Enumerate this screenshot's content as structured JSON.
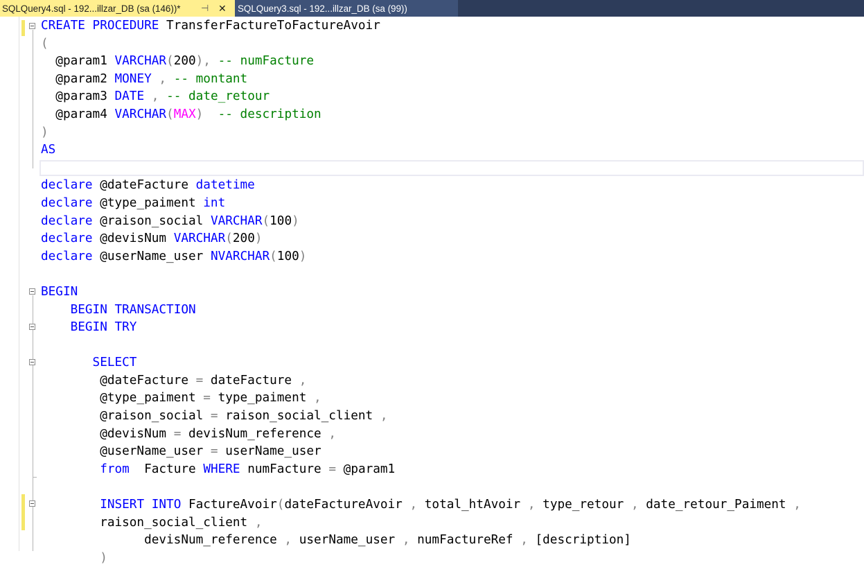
{
  "tabs": [
    {
      "label": "SQLQuery4.sql - 192...illzar_DB (sa (146))*",
      "active": true
    },
    {
      "label": "SQLQuery3.sql - 192...illzar_DB (sa (99))",
      "active": false
    }
  ],
  "tab_icons": {
    "pin": "pin-icon",
    "close": "close-icon"
  },
  "colors": {
    "keyword": "#0000ff",
    "comment": "#008000",
    "operator": "#808080",
    "function": "#ff00ff",
    "active_tab": "#ffef8f",
    "inactive_tab": "#3e5278",
    "tabbar": "#2d3c5a"
  },
  "code_lines": [
    [
      [
        "kw",
        "CREATE PROCEDURE"
      ],
      [
        "t",
        " TransferFactureToFactureAvoir"
      ]
    ],
    [
      [
        "gr",
        "("
      ]
    ],
    [
      [
        "t",
        "  @param1 "
      ],
      [
        "kw",
        "VARCHAR"
      ],
      [
        "gr",
        "("
      ],
      [
        "t",
        "200"
      ],
      [
        "gr",
        "),"
      ],
      [
        "cm",
        " -- numFacture"
      ]
    ],
    [
      [
        "t",
        "  @param2 "
      ],
      [
        "kw",
        "MONEY"
      ],
      [
        "gr",
        " ,"
      ],
      [
        "cm",
        " -- montant"
      ]
    ],
    [
      [
        "t",
        "  @param3 "
      ],
      [
        "kw",
        "DATE"
      ],
      [
        "gr",
        " ,"
      ],
      [
        "cm",
        " -- date_retour"
      ]
    ],
    [
      [
        "t",
        "  @param4 "
      ],
      [
        "kw",
        "VARCHAR"
      ],
      [
        "gr",
        "("
      ],
      [
        "fn",
        "MAX"
      ],
      [
        "gr",
        ")"
      ],
      [
        "cm",
        "  -- description"
      ]
    ],
    [
      [
        "gr",
        ")"
      ]
    ],
    [
      [
        "kw",
        "AS"
      ]
    ],
    [],
    [
      [
        "kw",
        "declare"
      ],
      [
        "t",
        " @dateFacture "
      ],
      [
        "kw",
        "datetime"
      ]
    ],
    [
      [
        "kw",
        "declare"
      ],
      [
        "t",
        " @type_paiment "
      ],
      [
        "kw",
        "int"
      ]
    ],
    [
      [
        "kw",
        "declare"
      ],
      [
        "t",
        " @raison_social "
      ],
      [
        "kw",
        "VARCHAR"
      ],
      [
        "gr",
        "("
      ],
      [
        "t",
        "100"
      ],
      [
        "gr",
        ")"
      ]
    ],
    [
      [
        "kw",
        "declare"
      ],
      [
        "t",
        " @devisNum "
      ],
      [
        "kw",
        "VARCHAR"
      ],
      [
        "gr",
        "("
      ],
      [
        "t",
        "200"
      ],
      [
        "gr",
        ")"
      ]
    ],
    [
      [
        "kw",
        "declare"
      ],
      [
        "t",
        " @userName_user "
      ],
      [
        "kw",
        "NVARCHAR"
      ],
      [
        "gr",
        "("
      ],
      [
        "t",
        "100"
      ],
      [
        "gr",
        ")"
      ]
    ],
    [],
    [
      [
        "kw",
        "BEGIN"
      ]
    ],
    [
      [
        "t",
        "    "
      ],
      [
        "kw",
        "BEGIN TRANSACTION"
      ]
    ],
    [
      [
        "t",
        "    "
      ],
      [
        "kw",
        "BEGIN TRY"
      ]
    ],
    [],
    [
      [
        "t",
        "       "
      ],
      [
        "kw",
        "SELECT"
      ]
    ],
    [
      [
        "t",
        "        @dateFacture "
      ],
      [
        "gr",
        "="
      ],
      [
        "t",
        " dateFacture "
      ],
      [
        "gr",
        ","
      ]
    ],
    [
      [
        "t",
        "        @type_paiment "
      ],
      [
        "gr",
        "="
      ],
      [
        "t",
        " type_paiment "
      ],
      [
        "gr",
        ","
      ]
    ],
    [
      [
        "t",
        "        @raison_social "
      ],
      [
        "gr",
        "="
      ],
      [
        "t",
        " raison_social_client "
      ],
      [
        "gr",
        ","
      ]
    ],
    [
      [
        "t",
        "        @devisNum "
      ],
      [
        "gr",
        "="
      ],
      [
        "t",
        " devisNum_reference "
      ],
      [
        "gr",
        ","
      ]
    ],
    [
      [
        "t",
        "        @userName_user "
      ],
      [
        "gr",
        "="
      ],
      [
        "t",
        " userName_user"
      ]
    ],
    [
      [
        "t",
        "        "
      ],
      [
        "kw",
        "from"
      ],
      [
        "t",
        "  Facture "
      ],
      [
        "kw",
        "WHERE"
      ],
      [
        "t",
        " numFacture "
      ],
      [
        "gr",
        "="
      ],
      [
        "t",
        " @param1"
      ]
    ],
    [],
    [
      [
        "t",
        "        "
      ],
      [
        "kw",
        "INSERT INTO"
      ],
      [
        "t",
        " FactureAvoir"
      ],
      [
        "gr",
        "("
      ],
      [
        "t",
        "dateFactureAvoir "
      ],
      [
        "gr",
        ","
      ],
      [
        "t",
        " total_htAvoir "
      ],
      [
        "gr",
        ","
      ],
      [
        "t",
        " type_retour "
      ],
      [
        "gr",
        ","
      ],
      [
        "t",
        " date_retour_Paiment "
      ],
      [
        "gr",
        ","
      ]
    ],
    [
      [
        "t",
        "        raison_social_client "
      ],
      [
        "gr",
        ","
      ]
    ],
    [
      [
        "t",
        "              devisNum_reference "
      ],
      [
        "gr",
        ","
      ],
      [
        "t",
        " userName_user "
      ],
      [
        "gr",
        ","
      ],
      [
        "t",
        " numFactureRef "
      ],
      [
        "gr",
        ","
      ],
      [
        "t",
        " [description]"
      ]
    ],
    [
      [
        "t",
        "        "
      ],
      [
        "gr",
        ")"
      ]
    ]
  ]
}
